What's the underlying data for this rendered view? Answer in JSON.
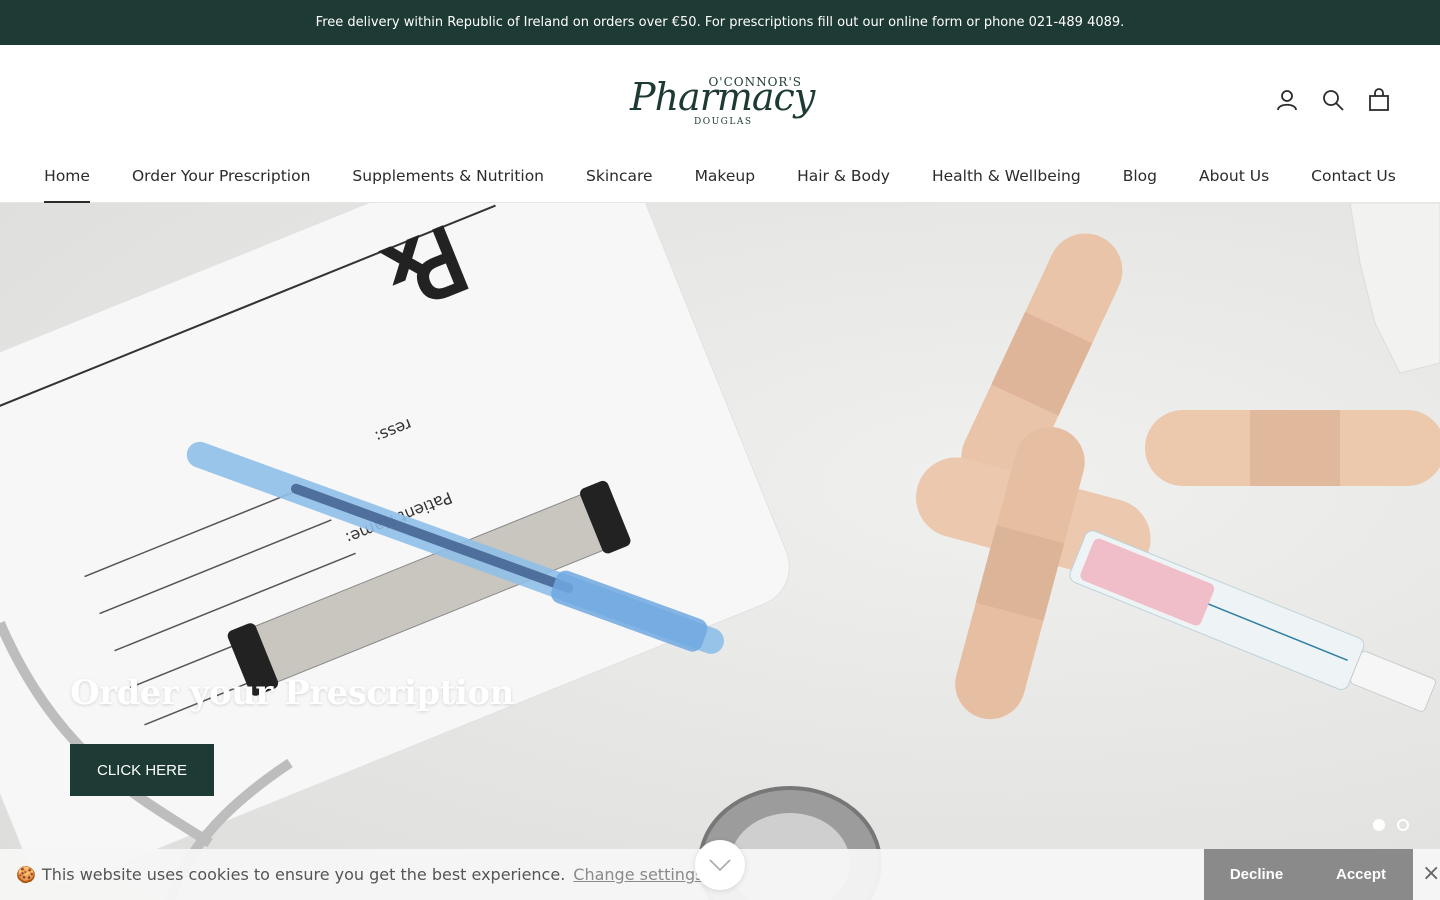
{
  "announcement": "Free delivery within Republic of Ireland on orders over €50. For prescriptions fill out our online form or phone 021-489 4089.",
  "logo": {
    "top": "O'CONNOR'S",
    "main": "Pharmacy",
    "bottom": "DOUGLAS"
  },
  "header_icons": [
    "account-icon",
    "search-icon",
    "bag-icon"
  ],
  "nav": {
    "items": [
      {
        "label": "Home",
        "active": true
      },
      {
        "label": "Order Your Prescription"
      },
      {
        "label": "Supplements & Nutrition"
      },
      {
        "label": "Skincare"
      },
      {
        "label": "Makeup"
      },
      {
        "label": "Hair & Body"
      },
      {
        "label": "Health & Wellbeing"
      },
      {
        "label": "Blog"
      },
      {
        "label": "About Us"
      },
      {
        "label": "Contact Us"
      }
    ]
  },
  "hero": {
    "title": "Order your Prescription",
    "button": "CLICK HERE",
    "image_text": {
      "rx_symbol": "℞",
      "patient_name": "Patient Name:",
      "address": "ress:"
    },
    "slides": 2,
    "active_slide": 1
  },
  "cookie": {
    "icon": "🍪",
    "text": "This website uses cookies to ensure you get the best experience.",
    "link": "Change settings",
    "decline": "Decline",
    "accept": "Accept",
    "close": "×"
  },
  "colors": {
    "brand": "#1e3a34",
    "cookie_button": "#8a8a8a"
  }
}
